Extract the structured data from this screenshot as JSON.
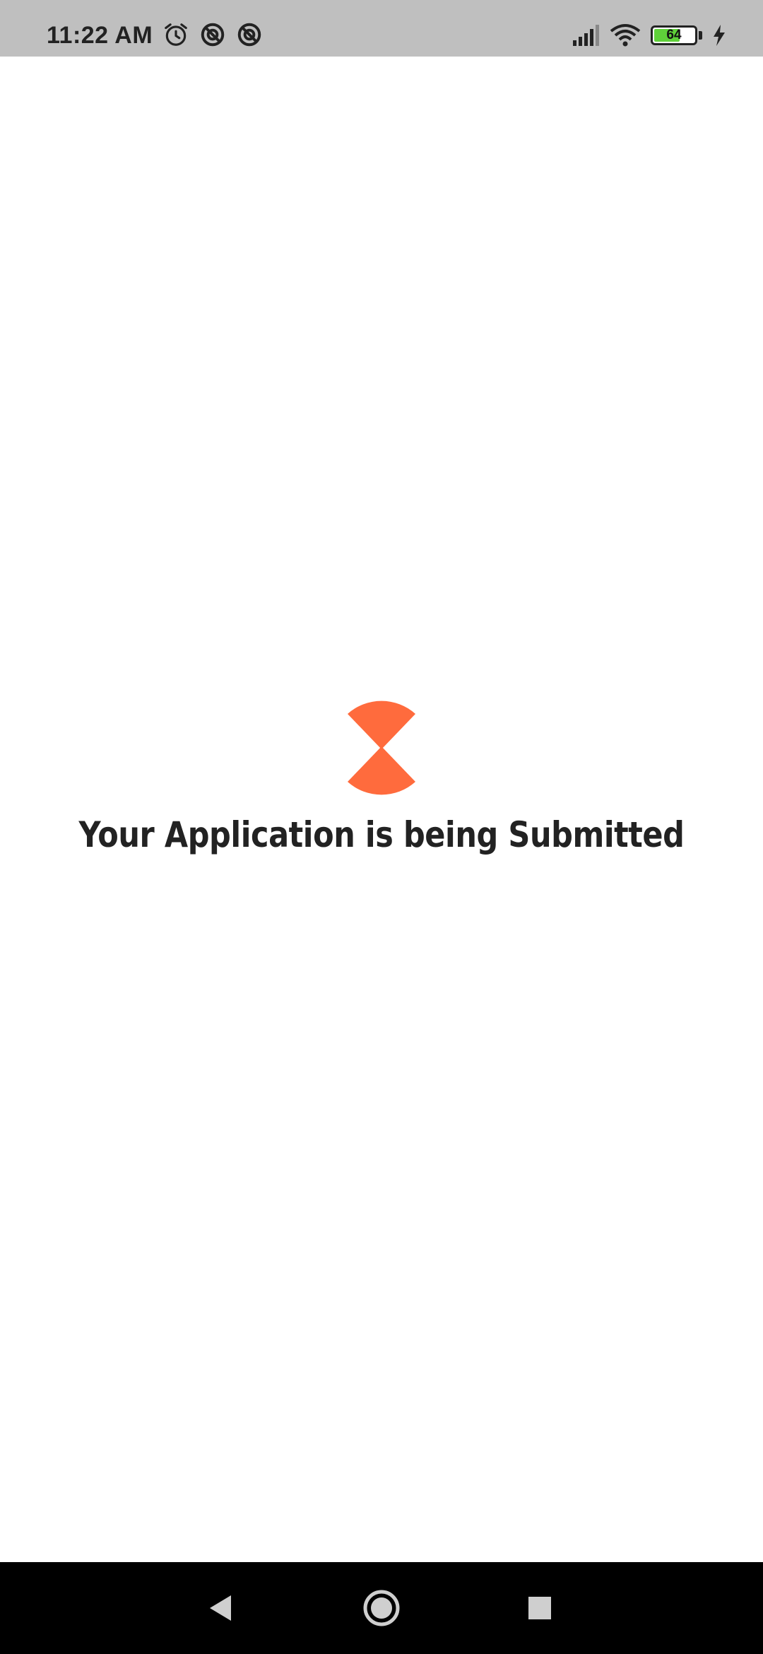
{
  "status_bar": {
    "time": "11:22 AM",
    "left_icons": [
      "alarm-icon",
      "data-saver-icon",
      "data-saver-icon"
    ],
    "right_icons": [
      "signal-icon",
      "wifi-icon",
      "battery-icon",
      "charging-icon"
    ],
    "battery_level": "64",
    "battery_fill_fraction": 0.64,
    "battery_color": "#5fd13a"
  },
  "main": {
    "loader_icon": "hourglass-icon",
    "loader_color": "#ff6b3d",
    "message": "Your Application is being Submitted"
  },
  "nav_bar": {
    "back_icon": "back-icon",
    "home_icon": "home-icon",
    "recents_icon": "recents-icon"
  }
}
